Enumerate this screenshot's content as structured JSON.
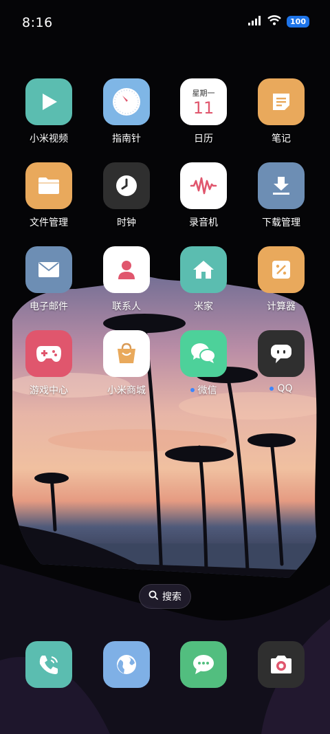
{
  "status_bar": {
    "time": "8:16",
    "battery": "100",
    "icons": [
      "signal-icon",
      "wifi-icon",
      "battery-icon"
    ]
  },
  "apps": [
    {
      "label": "小米视频",
      "icon": "play-icon",
      "color": "#5bbdb0"
    },
    {
      "label": "指南针",
      "icon": "compass-icon",
      "color": "#7fb6e6"
    },
    {
      "label": "日历",
      "icon": "calendar-icon",
      "color": "#ffffff",
      "weekday": "星期一",
      "day": "11"
    },
    {
      "label": "笔记",
      "icon": "note-icon",
      "color": "#e9a95c"
    },
    {
      "label": "文件管理",
      "icon": "folder-icon",
      "color": "#e9a95c"
    },
    {
      "label": "时钟",
      "icon": "clock-icon",
      "color": "#2f2f2f"
    },
    {
      "label": "录音机",
      "icon": "waveform-icon",
      "color": "#ffffff"
    },
    {
      "label": "下载管理",
      "icon": "download-icon",
      "color": "#6d8eb4"
    },
    {
      "label": "电子邮件",
      "icon": "mail-icon",
      "color": "#6d8eb4"
    },
    {
      "label": "联系人",
      "icon": "contact-icon",
      "color": "#ffffff"
    },
    {
      "label": "米家",
      "icon": "home-icon",
      "color": "#5bbdb0"
    },
    {
      "label": "计算器",
      "icon": "calculator-icon",
      "color": "#e9a95c"
    },
    {
      "label": "游戏中心",
      "icon": "gamepad-icon",
      "color": "#e0566d"
    },
    {
      "label": "小米商城",
      "icon": "shopping-bag-icon",
      "color": "#ffffff"
    },
    {
      "label": "微信",
      "icon": "wechat-icon",
      "color": "#4dd19a",
      "badge": true
    },
    {
      "label": "QQ",
      "icon": "qq-icon",
      "color": "#2f2f2f",
      "badge": true
    }
  ],
  "search": {
    "label": "搜索"
  },
  "dock": [
    {
      "name": "phone",
      "icon": "phone-icon",
      "color": "#5bbdb0"
    },
    {
      "name": "browser",
      "icon": "globe-icon",
      "color": "#7fb0e6"
    },
    {
      "name": "messages",
      "icon": "message-icon",
      "color": "#52be7f"
    },
    {
      "name": "camera",
      "icon": "camera-icon",
      "color": "#2f2f2f"
    }
  ]
}
